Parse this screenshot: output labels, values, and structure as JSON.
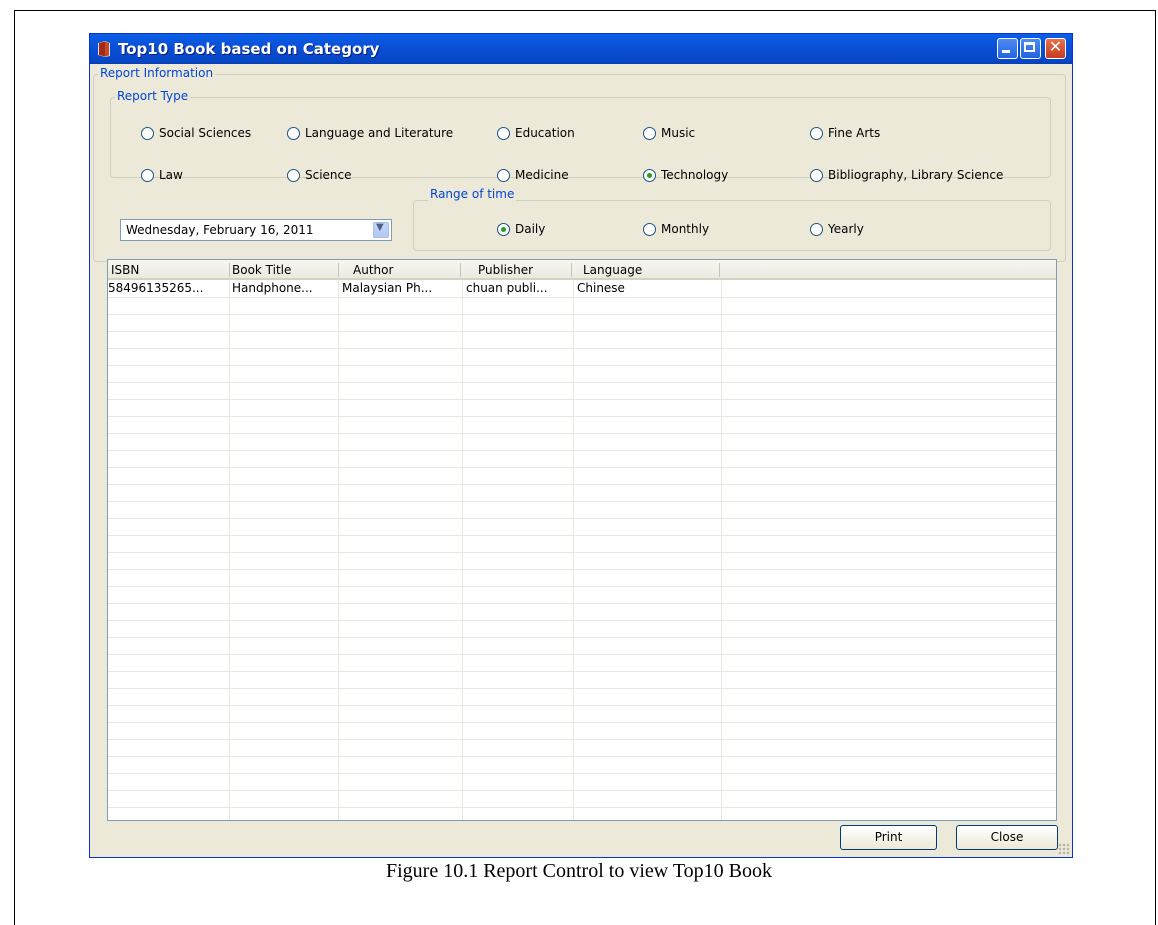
{
  "window": {
    "title": "Top10 Book based on Category"
  },
  "report_information": {
    "legend": "Report Information",
    "report_type": {
      "legend": "Report Type",
      "options": [
        {
          "label": "Social Sciences",
          "checked": false
        },
        {
          "label": "Language and Literature",
          "checked": false
        },
        {
          "label": "Education",
          "checked": false
        },
        {
          "label": "Music",
          "checked": false
        },
        {
          "label": "Fine Arts",
          "checked": false
        },
        {
          "label": "Law",
          "checked": false
        },
        {
          "label": "Science",
          "checked": false
        },
        {
          "label": "Medicine",
          "checked": false
        },
        {
          "label": "Technology",
          "checked": true
        },
        {
          "label": "Bibliography, Library Science",
          "checked": false
        }
      ]
    },
    "date_picker": {
      "value": "Wednesday,  February  16, 2011"
    },
    "range_of_time": {
      "legend": "Range of time",
      "options": [
        {
          "label": "Daily",
          "checked": true
        },
        {
          "label": "Monthly",
          "checked": false
        },
        {
          "label": "Yearly",
          "checked": false
        }
      ]
    }
  },
  "table": {
    "columns": [
      "ISBN",
      "Book Title",
      "Author",
      "Publisher",
      "Language"
    ],
    "rows": [
      [
        "58496135265...",
        "Handphone...",
        "Malaysian Ph...",
        "chuan publi...",
        "Chinese"
      ]
    ]
  },
  "buttons": {
    "print": "Print",
    "close": "Close"
  },
  "caption": "Figure 10.1 Report Control to view Top10 Book",
  "colors": {
    "titlebar": "#0a50d8",
    "legend_text": "#0046d5",
    "window_bg": "#ece9d8",
    "radio_dot": "#21a121"
  },
  "icons": [
    "book-icon",
    "minimize-icon",
    "maximize-icon",
    "close-icon",
    "dropdown-arrow-icon",
    "resize-grip-icon"
  ]
}
